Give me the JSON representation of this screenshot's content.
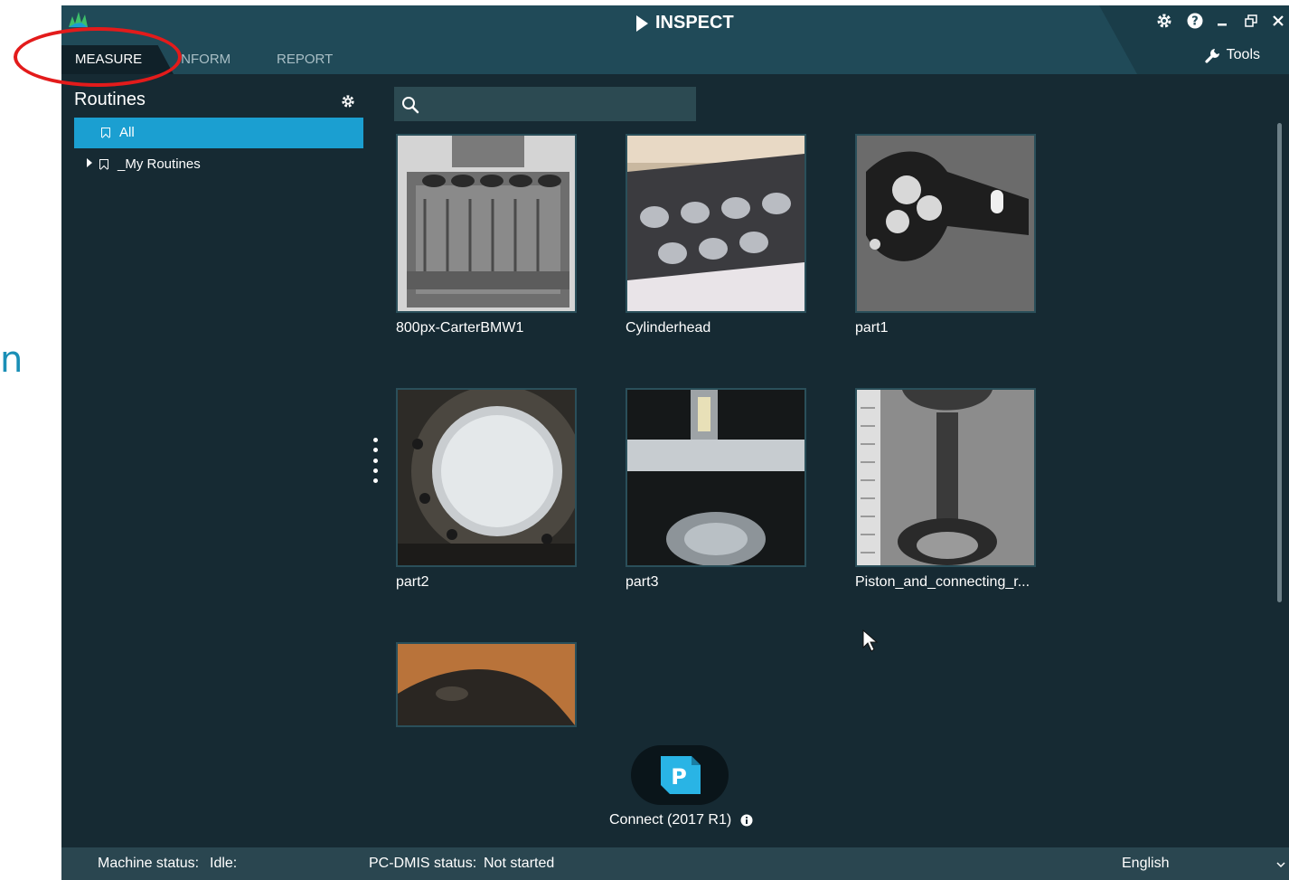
{
  "background_text": "n",
  "app": {
    "title": "INSPECT",
    "tools_label": "Tools"
  },
  "tabs": [
    {
      "label": "MEASURE"
    },
    {
      "label": "INFORM"
    },
    {
      "label": "REPORT"
    }
  ],
  "sidebar": {
    "title": "Routines",
    "items": [
      {
        "label": "All"
      },
      {
        "label": "_My Routines"
      }
    ]
  },
  "search": {
    "value": "",
    "placeholder": ""
  },
  "routines": [
    {
      "name": "800px-CarterBMW1"
    },
    {
      "name": "Cylinderhead"
    },
    {
      "name": "part1"
    },
    {
      "name": "part2"
    },
    {
      "name": "part3"
    },
    {
      "name": "Piston_and_connecting_r..."
    },
    {
      "name": ""
    }
  ],
  "connect": {
    "label": "Connect (2017 R1)",
    "icon_letter": "P"
  },
  "status": {
    "machine_label": "Machine status:",
    "machine_value": "Idle:",
    "pcdmis_label": "PC-DMIS status:",
    "pcdmis_value": "Not started",
    "language": "English"
  },
  "colors": {
    "accent": "#1b9fd1",
    "titlebar": "#204a58",
    "panel": "#162a33",
    "highlight_ring": "#e31b1b"
  }
}
